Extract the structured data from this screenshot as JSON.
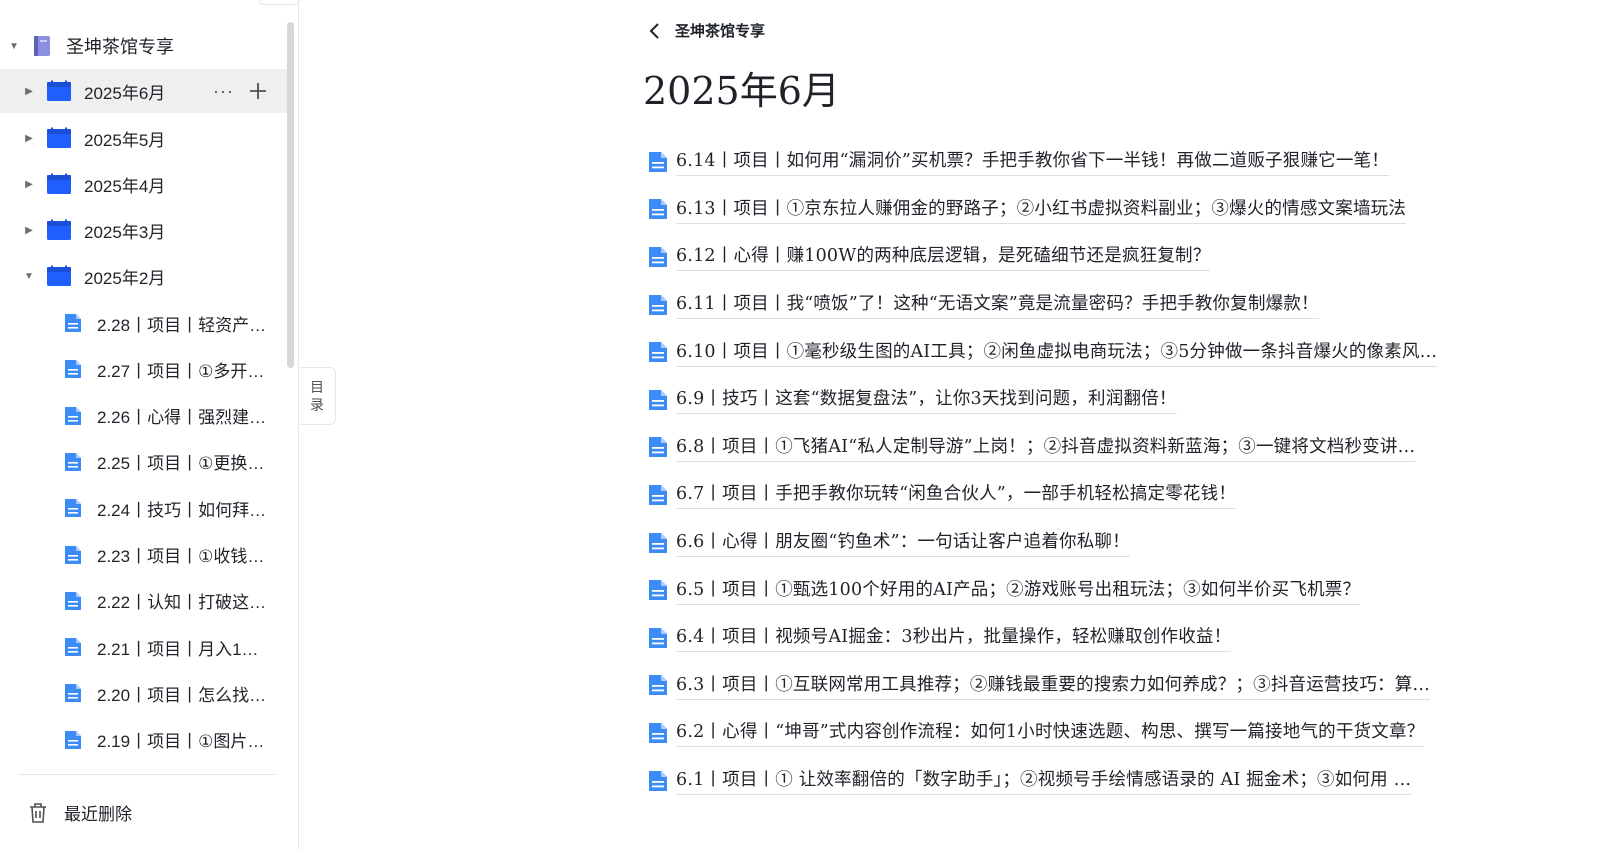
{
  "sidebar": {
    "root": {
      "label": "圣坤茶馆专享",
      "expanded": true
    },
    "months": [
      {
        "label": "2025年6月",
        "selected": true,
        "expanded": false
      },
      {
        "label": "2025年5月",
        "selected": false,
        "expanded": false
      },
      {
        "label": "2025年4月",
        "selected": false,
        "expanded": false
      },
      {
        "label": "2025年3月",
        "selected": false,
        "expanded": false
      },
      {
        "label": "2025年2月",
        "selected": false,
        "expanded": true
      }
    ],
    "row_actions": {
      "more": "···"
    },
    "feb_docs": [
      "2.28丨项目丨轻资产…",
      "2.27丨项目丨①多开…",
      "2.26丨心得丨强烈建…",
      "2.25丨项目丨①更换…",
      "2.24丨技巧丨如何拜…",
      "2.23丨项目丨①收钱…",
      "2.22丨认知丨打破这…",
      "2.21丨项目丨月入1…",
      "2.20丨项目丨怎么找…",
      "2.19丨项目丨①图片…"
    ],
    "trash_label": "最近删除",
    "toc_tab": [
      "目",
      "录"
    ]
  },
  "main": {
    "breadcrumb_title": "圣坤茶馆专享",
    "page_title": "2025年6月",
    "docs": [
      "6.14丨项目丨如何用“漏洞价”买机票？手把手教你省下一半钱！再做二道贩子狠赚它一笔！",
      "6.13丨项目丨①京东拉人赚佣金的野路子；②小红书虚拟资料副业；③爆火的情感文案墙玩法",
      "6.12丨心得丨赚100W的两种底层逻辑，是死磕细节还是疯狂复制？",
      "6.11丨项目丨我“喷饭”了！这种“无语文案”竟是流量密码？手把手教你复制爆款！",
      "6.10丨项目丨①毫秒级生图的AI工具；②闲鱼虚拟电商玩法；③5分钟做一条抖音爆火的像素风…",
      "6.9丨技巧丨这套“数据复盘法”，让你3天找到问题，利润翻倍！",
      "6.8丨项目丨①飞猪AI“私人定制导游”上岗！；②抖音虚拟资料新蓝海；③一键将文档秒变讲…",
      "6.7丨项目丨手把手教你玩转“闲鱼合伙人”，一部手机轻松搞定零花钱！",
      "6.6丨心得丨朋友圈“钓鱼术”：一句话让客户追着你私聊！",
      "6.5丨项目丨①甄选100个好用的AI产品；②游戏账号出租玩法；③如何半价买飞机票？",
      "6.4丨项目丨视频号AI掘金：3秒出片，批量操作，轻松赚取创作收益！",
      "6.3丨项目丨①互联网常用工具推荐；②赚钱最重要的搜索力如何养成？；③抖音运营技巧：算…",
      "6.2丨心得丨“坤哥”式内容创作流程：如何1小时快速选题、构思、撰写一篇接地气的干货文章？",
      "6.1丨项目丨① 让效率翻倍的「数字助手」；②视频号手绘情感语录的 AI 掘金术；③如何用 …"
    ]
  },
  "colors": {
    "folder_blue": "#1f5eff",
    "doc_blue": "#3b8cf7",
    "book_purple": "#7d82d9",
    "selected_bg": "#efefef"
  }
}
